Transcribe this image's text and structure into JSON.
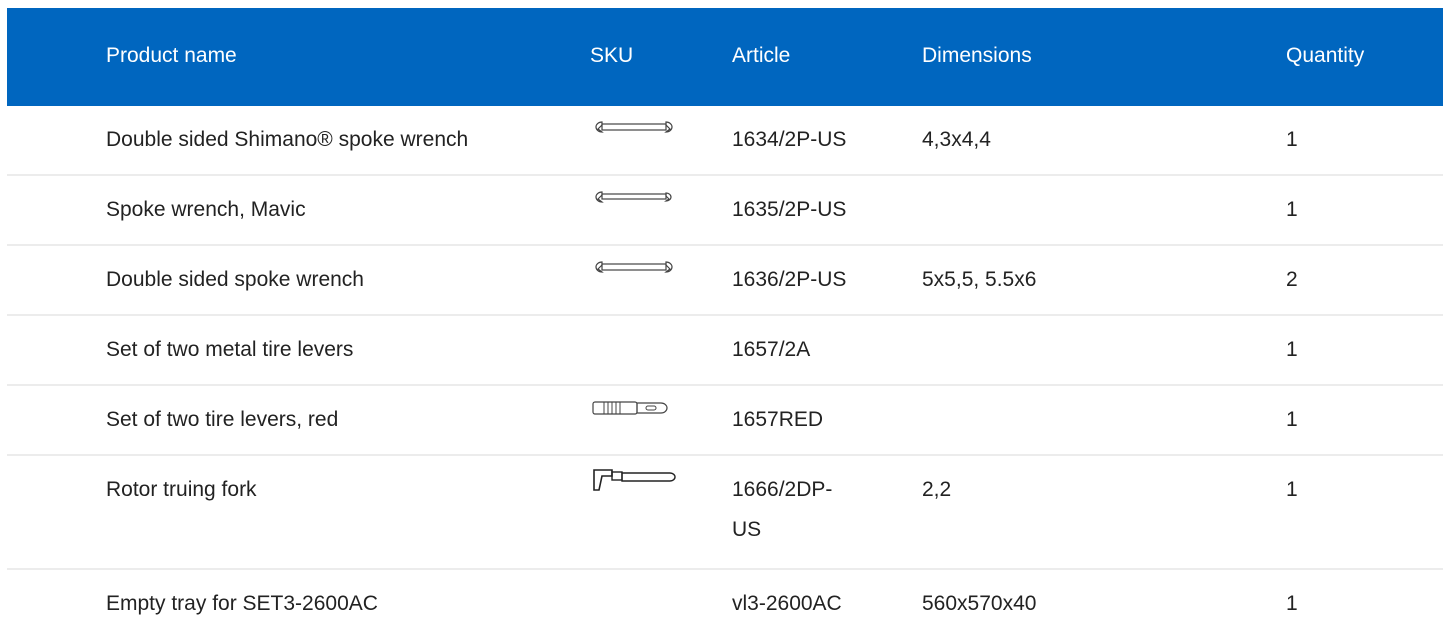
{
  "table": {
    "headers": {
      "name": "Product name",
      "sku": "SKU",
      "article": "Article",
      "dimensions": "Dimensions",
      "quantity": "Quantity"
    },
    "rows": [
      {
        "name": "Double sided Shimano® spoke wrench",
        "sku_icon": "double-spoke-wrench-icon",
        "article": "1634/2P-US",
        "dimensions": "4,3x4,4",
        "quantity": "1"
      },
      {
        "name": "Spoke wrench, Mavic",
        "sku_icon": "spoke-wrench-icon",
        "article": "1635/2P-US",
        "dimensions": "",
        "quantity": "1"
      },
      {
        "name": "Double sided spoke wrench",
        "sku_icon": "double-spoke-wrench-icon",
        "article": "1636/2P-US",
        "dimensions": "5x5,5, 5.5x6",
        "quantity": "2"
      },
      {
        "name": "Set of two metal tire levers",
        "sku_icon": "",
        "article": "1657/2A",
        "dimensions": "",
        "quantity": "1"
      },
      {
        "name": "Set of two tire levers, red",
        "sku_icon": "tire-lever-icon",
        "article": "1657RED",
        "dimensions": "",
        "quantity": "1"
      },
      {
        "name": "Rotor truing fork",
        "sku_icon": "truing-fork-icon",
        "article": "1666/2DP-US",
        "dimensions": "2,2",
        "quantity": "1"
      },
      {
        "name": "Empty tray for SET3-2600AC",
        "sku_icon": "",
        "article": "vl3-2600AC",
        "dimensions": "560x570x40",
        "quantity": "1"
      }
    ]
  },
  "colors": {
    "header_bg": "#0066bf",
    "header_text": "#ffffff",
    "row_divider": "#ececec"
  }
}
